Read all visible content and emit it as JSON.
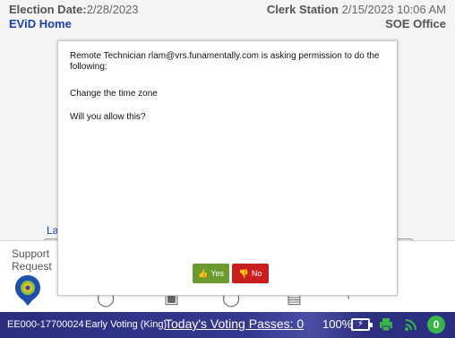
{
  "header": {
    "election_date_label": "Election Date:",
    "election_date_value": "2/28/2023",
    "app_title": "EViD Home",
    "station_label": "Clerk Station",
    "station_datetime": "2/15/2023 10:06 AM",
    "office": "SOE Office"
  },
  "background": {
    "partial_label": "La",
    "support_line1": "Support",
    "support_line2": "Request"
  },
  "dialog": {
    "message": "Remote Technician rlam@vrs.funamentally.com is asking permission to do the following:",
    "action": "Change the time zone",
    "question": "Will you allow this?",
    "yes_label": "Yes",
    "no_label": "No"
  },
  "status_bar": {
    "station_id": "EE000-17700024",
    "voting_mode": "Early Voting (King)",
    "passes_text": "Today's Voting Passes: 0",
    "battery_percent": "100%",
    "notification_count": "0"
  },
  "colors": {
    "brand_blue": "#1a3fa6",
    "status_bar": "#2b2d7e",
    "yes_green": "#6b9a2e",
    "no_red": "#c81e1e",
    "badge_green": "#39b54a"
  },
  "icons": [
    "support-gear-icon",
    "thumbs-up-icon",
    "thumbs-down-icon",
    "battery-charging-icon",
    "printer-icon",
    "wifi-icon"
  ]
}
